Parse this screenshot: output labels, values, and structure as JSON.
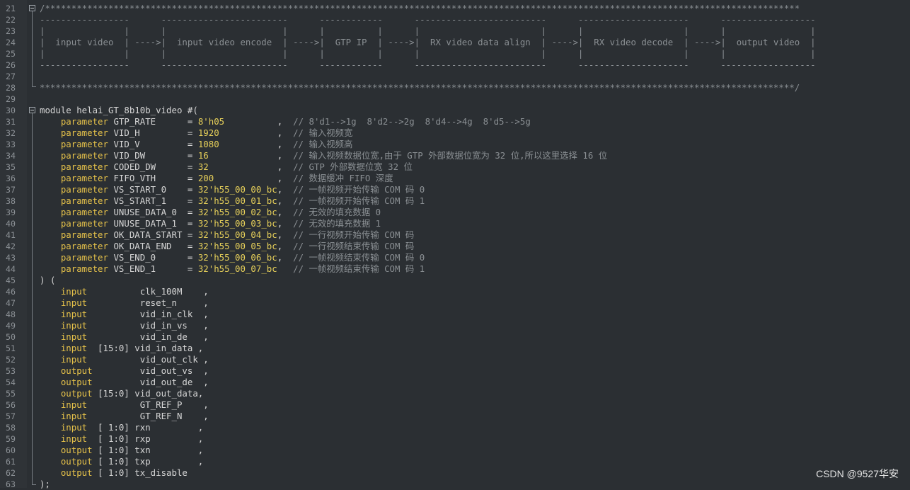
{
  "editor": {
    "line_numbers": [
      "21",
      "22",
      "23",
      "24",
      "25",
      "26",
      "27",
      "28",
      "29",
      "30",
      "31",
      "32",
      "33",
      "34",
      "35",
      "36",
      "37",
      "38",
      "39",
      "40",
      "41",
      "42",
      "43",
      "44",
      "45",
      "46",
      "47",
      "48",
      "49",
      "50",
      "51",
      "52",
      "53",
      "54",
      "55",
      "56",
      "57",
      "58",
      "59",
      "60",
      "61",
      "62",
      "63"
    ],
    "lines": [
      [
        {
          "t": "/***********************************************************************************************************************************************",
          "c": "cmt"
        }
      ],
      [
        {
          "t": "-----------------      ------------------------      ------------      -------------------------      ---------------------      ------------------",
          "c": "hdr"
        }
      ],
      [
        {
          "t": "|               |      |                      |      |          |      |                       |      |                   |      |                |",
          "c": "hdr"
        }
      ],
      [
        {
          "t": "|  input video  | ---->|  input video encode  | ---->|  GTP IP  | ---->|  RX video data align  | ---->|  RX video decode  | ---->|  output video  |",
          "c": "hdr"
        }
      ],
      [
        {
          "t": "|               |      |                      |      |          |      |                       |      |                   |      |                |",
          "c": "hdr"
        }
      ],
      [
        {
          "t": "-----------------      ------------------------      ------------      -------------------------      ---------------------      ------------------",
          "c": "hdr"
        }
      ],
      [
        {
          "t": "",
          "c": ""
        }
      ],
      [
        {
          "t": "***********************************************************************************************************************************************/",
          "c": "cmt"
        }
      ],
      [
        {
          "t": "",
          "c": ""
        }
      ],
      [
        {
          "t": "module helai_GT_8b10b_video #(",
          "c": ""
        }
      ],
      [
        {
          "t": "    parameter",
          "c": "kw"
        },
        {
          "t": " GTP_RATE      = ",
          "c": ""
        },
        {
          "t": "8'h05",
          "c": "num"
        },
        {
          "t": "          ,  ",
          "c": ""
        },
        {
          "t": "// 8'd1-->1g  8'd2-->2g  8'd4-->4g  8'd5-->5g",
          "c": "cmt"
        }
      ],
      [
        {
          "t": "    parameter",
          "c": "kw"
        },
        {
          "t": " VID_H         = ",
          "c": ""
        },
        {
          "t": "1920",
          "c": "num"
        },
        {
          "t": "           ,  ",
          "c": ""
        },
        {
          "t": "// 输入视频宽",
          "c": "cmt"
        }
      ],
      [
        {
          "t": "    parameter",
          "c": "kw"
        },
        {
          "t": " VID_V         = ",
          "c": ""
        },
        {
          "t": "1080",
          "c": "num"
        },
        {
          "t": "           ,  ",
          "c": ""
        },
        {
          "t": "// 输入视频高",
          "c": "cmt"
        }
      ],
      [
        {
          "t": "    parameter",
          "c": "kw"
        },
        {
          "t": " VID_DW        = ",
          "c": ""
        },
        {
          "t": "16",
          "c": "num"
        },
        {
          "t": "             ,  ",
          "c": ""
        },
        {
          "t": "// 输入视频数据位宽,由于 GTP 外部数据位宽为 32 位,所以这里选择 16 位",
          "c": "cmt"
        }
      ],
      [
        {
          "t": "    parameter",
          "c": "kw"
        },
        {
          "t": " CODED_DW      = ",
          "c": ""
        },
        {
          "t": "32",
          "c": "num"
        },
        {
          "t": "             ,  ",
          "c": ""
        },
        {
          "t": "// GTP 外部数据位宽 32 位",
          "c": "cmt"
        }
      ],
      [
        {
          "t": "    parameter",
          "c": "kw"
        },
        {
          "t": " FIFO_VTH      = ",
          "c": ""
        },
        {
          "t": "200",
          "c": "num"
        },
        {
          "t": "            ,  ",
          "c": ""
        },
        {
          "t": "// 数据缓冲 FIFO 深度",
          "c": "cmt"
        }
      ],
      [
        {
          "t": "    parameter",
          "c": "kw"
        },
        {
          "t": " VS_START_0    = ",
          "c": ""
        },
        {
          "t": "32'h55_00_00_bc",
          "c": "num"
        },
        {
          "t": ",  ",
          "c": ""
        },
        {
          "t": "// 一帧视频开始传输 COM 码 0",
          "c": "cmt"
        }
      ],
      [
        {
          "t": "    parameter",
          "c": "kw"
        },
        {
          "t": " VS_START_1    = ",
          "c": ""
        },
        {
          "t": "32'h55_00_01_bc",
          "c": "num"
        },
        {
          "t": ",  ",
          "c": ""
        },
        {
          "t": "// 一帧视频开始传输 COM 码 1",
          "c": "cmt"
        }
      ],
      [
        {
          "t": "    parameter",
          "c": "kw"
        },
        {
          "t": " UNUSE_DATA_0  = ",
          "c": ""
        },
        {
          "t": "32'h55_00_02_bc",
          "c": "num"
        },
        {
          "t": ",  ",
          "c": ""
        },
        {
          "t": "// 无效的填充数据 0",
          "c": "cmt"
        }
      ],
      [
        {
          "t": "    parameter",
          "c": "kw"
        },
        {
          "t": " UNUSE_DATA_1  = ",
          "c": ""
        },
        {
          "t": "32'h55_00_03_bc",
          "c": "num"
        },
        {
          "t": ",  ",
          "c": ""
        },
        {
          "t": "// 无效的填充数据 1",
          "c": "cmt"
        }
      ],
      [
        {
          "t": "    parameter",
          "c": "kw"
        },
        {
          "t": " OK_DATA_START = ",
          "c": ""
        },
        {
          "t": "32'h55_00_04_bc",
          "c": "num"
        },
        {
          "t": ",  ",
          "c": ""
        },
        {
          "t": "// 一行视频开始传输 COM 码",
          "c": "cmt"
        }
      ],
      [
        {
          "t": "    parameter",
          "c": "kw"
        },
        {
          "t": " OK_DATA_END   = ",
          "c": ""
        },
        {
          "t": "32'h55_00_05_bc",
          "c": "num"
        },
        {
          "t": ",  ",
          "c": ""
        },
        {
          "t": "// 一行视频结束传输 COM 码",
          "c": "cmt"
        }
      ],
      [
        {
          "t": "    parameter",
          "c": "kw"
        },
        {
          "t": " VS_END_0      = ",
          "c": ""
        },
        {
          "t": "32'h55_00_06_bc",
          "c": "num"
        },
        {
          "t": ",  ",
          "c": ""
        },
        {
          "t": "// 一帧视频结束传输 COM 码 0",
          "c": "cmt"
        }
      ],
      [
        {
          "t": "    parameter",
          "c": "kw"
        },
        {
          "t": " VS_END_1      = ",
          "c": ""
        },
        {
          "t": "32'h55_00_07_bc",
          "c": "num"
        },
        {
          "t": "   ",
          "c": ""
        },
        {
          "t": "// 一帧视频结束传输 COM 码 1",
          "c": "cmt"
        }
      ],
      [
        {
          "t": ") (",
          "c": ""
        }
      ],
      [
        {
          "t": "    input",
          "c": "kw"
        },
        {
          "t": "          clk_100M    ,",
          "c": ""
        }
      ],
      [
        {
          "t": "    input",
          "c": "kw"
        },
        {
          "t": "          reset_n     ,",
          "c": ""
        }
      ],
      [
        {
          "t": "    input",
          "c": "kw"
        },
        {
          "t": "          vid_in_clk  ,",
          "c": ""
        }
      ],
      [
        {
          "t": "    input",
          "c": "kw"
        },
        {
          "t": "          vid_in_vs   ,",
          "c": ""
        }
      ],
      [
        {
          "t": "    input",
          "c": "kw"
        },
        {
          "t": "          vid_in_de   ,",
          "c": ""
        }
      ],
      [
        {
          "t": "    input",
          "c": "kw"
        },
        {
          "t": "  [15:0] vid_in_data ,",
          "c": ""
        }
      ],
      [
        {
          "t": "    input",
          "c": "kw"
        },
        {
          "t": "          vid_out_clk ,",
          "c": ""
        }
      ],
      [
        {
          "t": "    output",
          "c": "kw"
        },
        {
          "t": "         vid_out_vs  ,",
          "c": ""
        }
      ],
      [
        {
          "t": "    output",
          "c": "kw"
        },
        {
          "t": "         vid_out_de  ,",
          "c": ""
        }
      ],
      [
        {
          "t": "    output",
          "c": "kw"
        },
        {
          "t": " [15:0] vid_out_data,",
          "c": ""
        }
      ],
      [
        {
          "t": "    input",
          "c": "kw"
        },
        {
          "t": "          GT_REF_P    ,",
          "c": ""
        }
      ],
      [
        {
          "t": "    input",
          "c": "kw"
        },
        {
          "t": "          GT_REF_N    ,",
          "c": ""
        }
      ],
      [
        {
          "t": "    input",
          "c": "kw"
        },
        {
          "t": "  [ 1:0] rxn         ,",
          "c": ""
        }
      ],
      [
        {
          "t": "    input",
          "c": "kw"
        },
        {
          "t": "  [ 1:0] rxp         ,",
          "c": ""
        }
      ],
      [
        {
          "t": "    output",
          "c": "kw"
        },
        {
          "t": " [ 1:0] txn         ,",
          "c": ""
        }
      ],
      [
        {
          "t": "    output",
          "c": "kw"
        },
        {
          "t": " [ 1:0] txp         ,",
          "c": ""
        }
      ],
      [
        {
          "t": "    output",
          "c": "kw"
        },
        {
          "t": " [ 1:0] tx_disable",
          "c": ""
        }
      ],
      [
        {
          "t": ");",
          "c": ""
        }
      ]
    ]
  },
  "watermark": "CSDN @9527华安"
}
